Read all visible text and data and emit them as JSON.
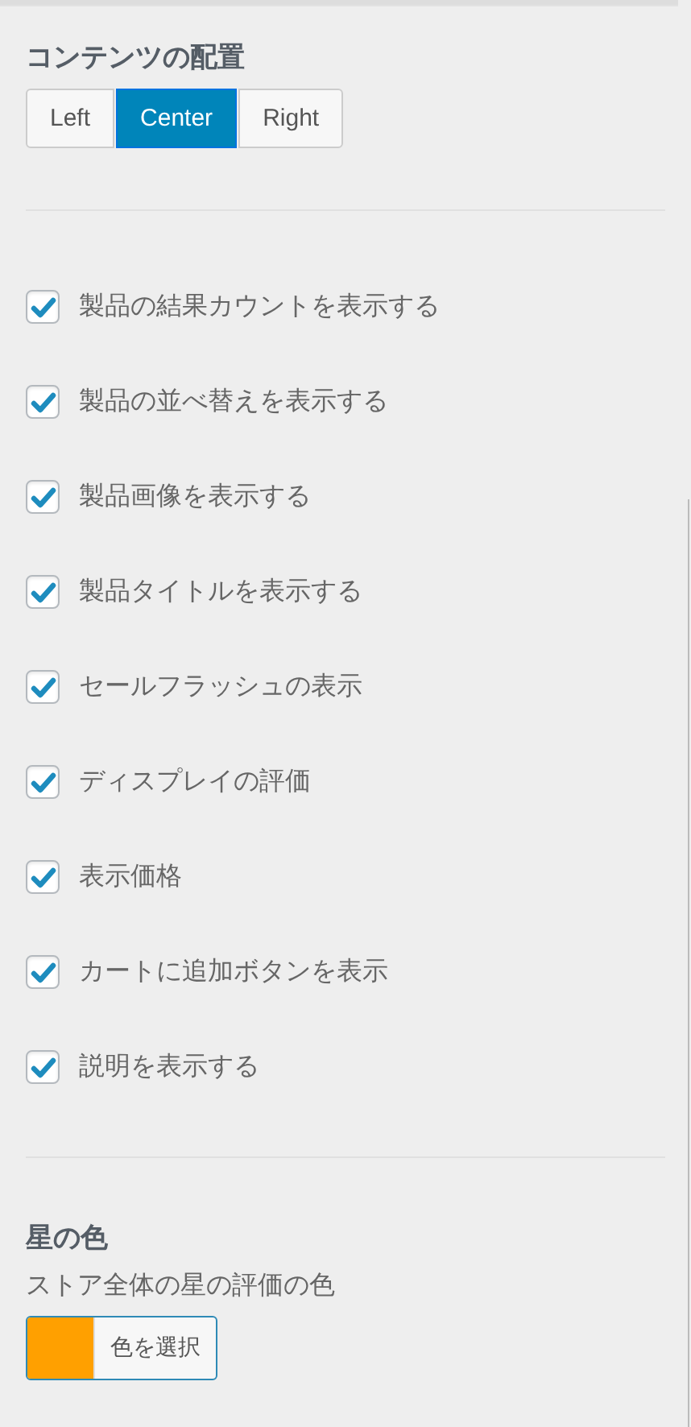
{
  "alignment": {
    "title": "コンテンツの配置",
    "options": [
      {
        "label": "Left",
        "selected": false
      },
      {
        "label": "Center",
        "selected": true
      },
      {
        "label": "Right",
        "selected": false
      }
    ]
  },
  "options": [
    {
      "label": "製品の結果カウントを表示する",
      "checked": true
    },
    {
      "label": "製品の並べ替えを表示する",
      "checked": true
    },
    {
      "label": "製品画像を表示する",
      "checked": true
    },
    {
      "label": "製品タイトルを表示する",
      "checked": true
    },
    {
      "label": "セールフラッシュの表示",
      "checked": true
    },
    {
      "label": "ディスプレイの評価",
      "checked": true
    },
    {
      "label": "表示価格",
      "checked": true
    },
    {
      "label": "カートに追加ボタンを表示",
      "checked": true
    },
    {
      "label": "説明を表示する",
      "checked": true
    }
  ],
  "star_color": {
    "title": "星の色",
    "description": "ストア全体の星の評価の色",
    "button": "色を選択",
    "color": "#ffa000"
  }
}
